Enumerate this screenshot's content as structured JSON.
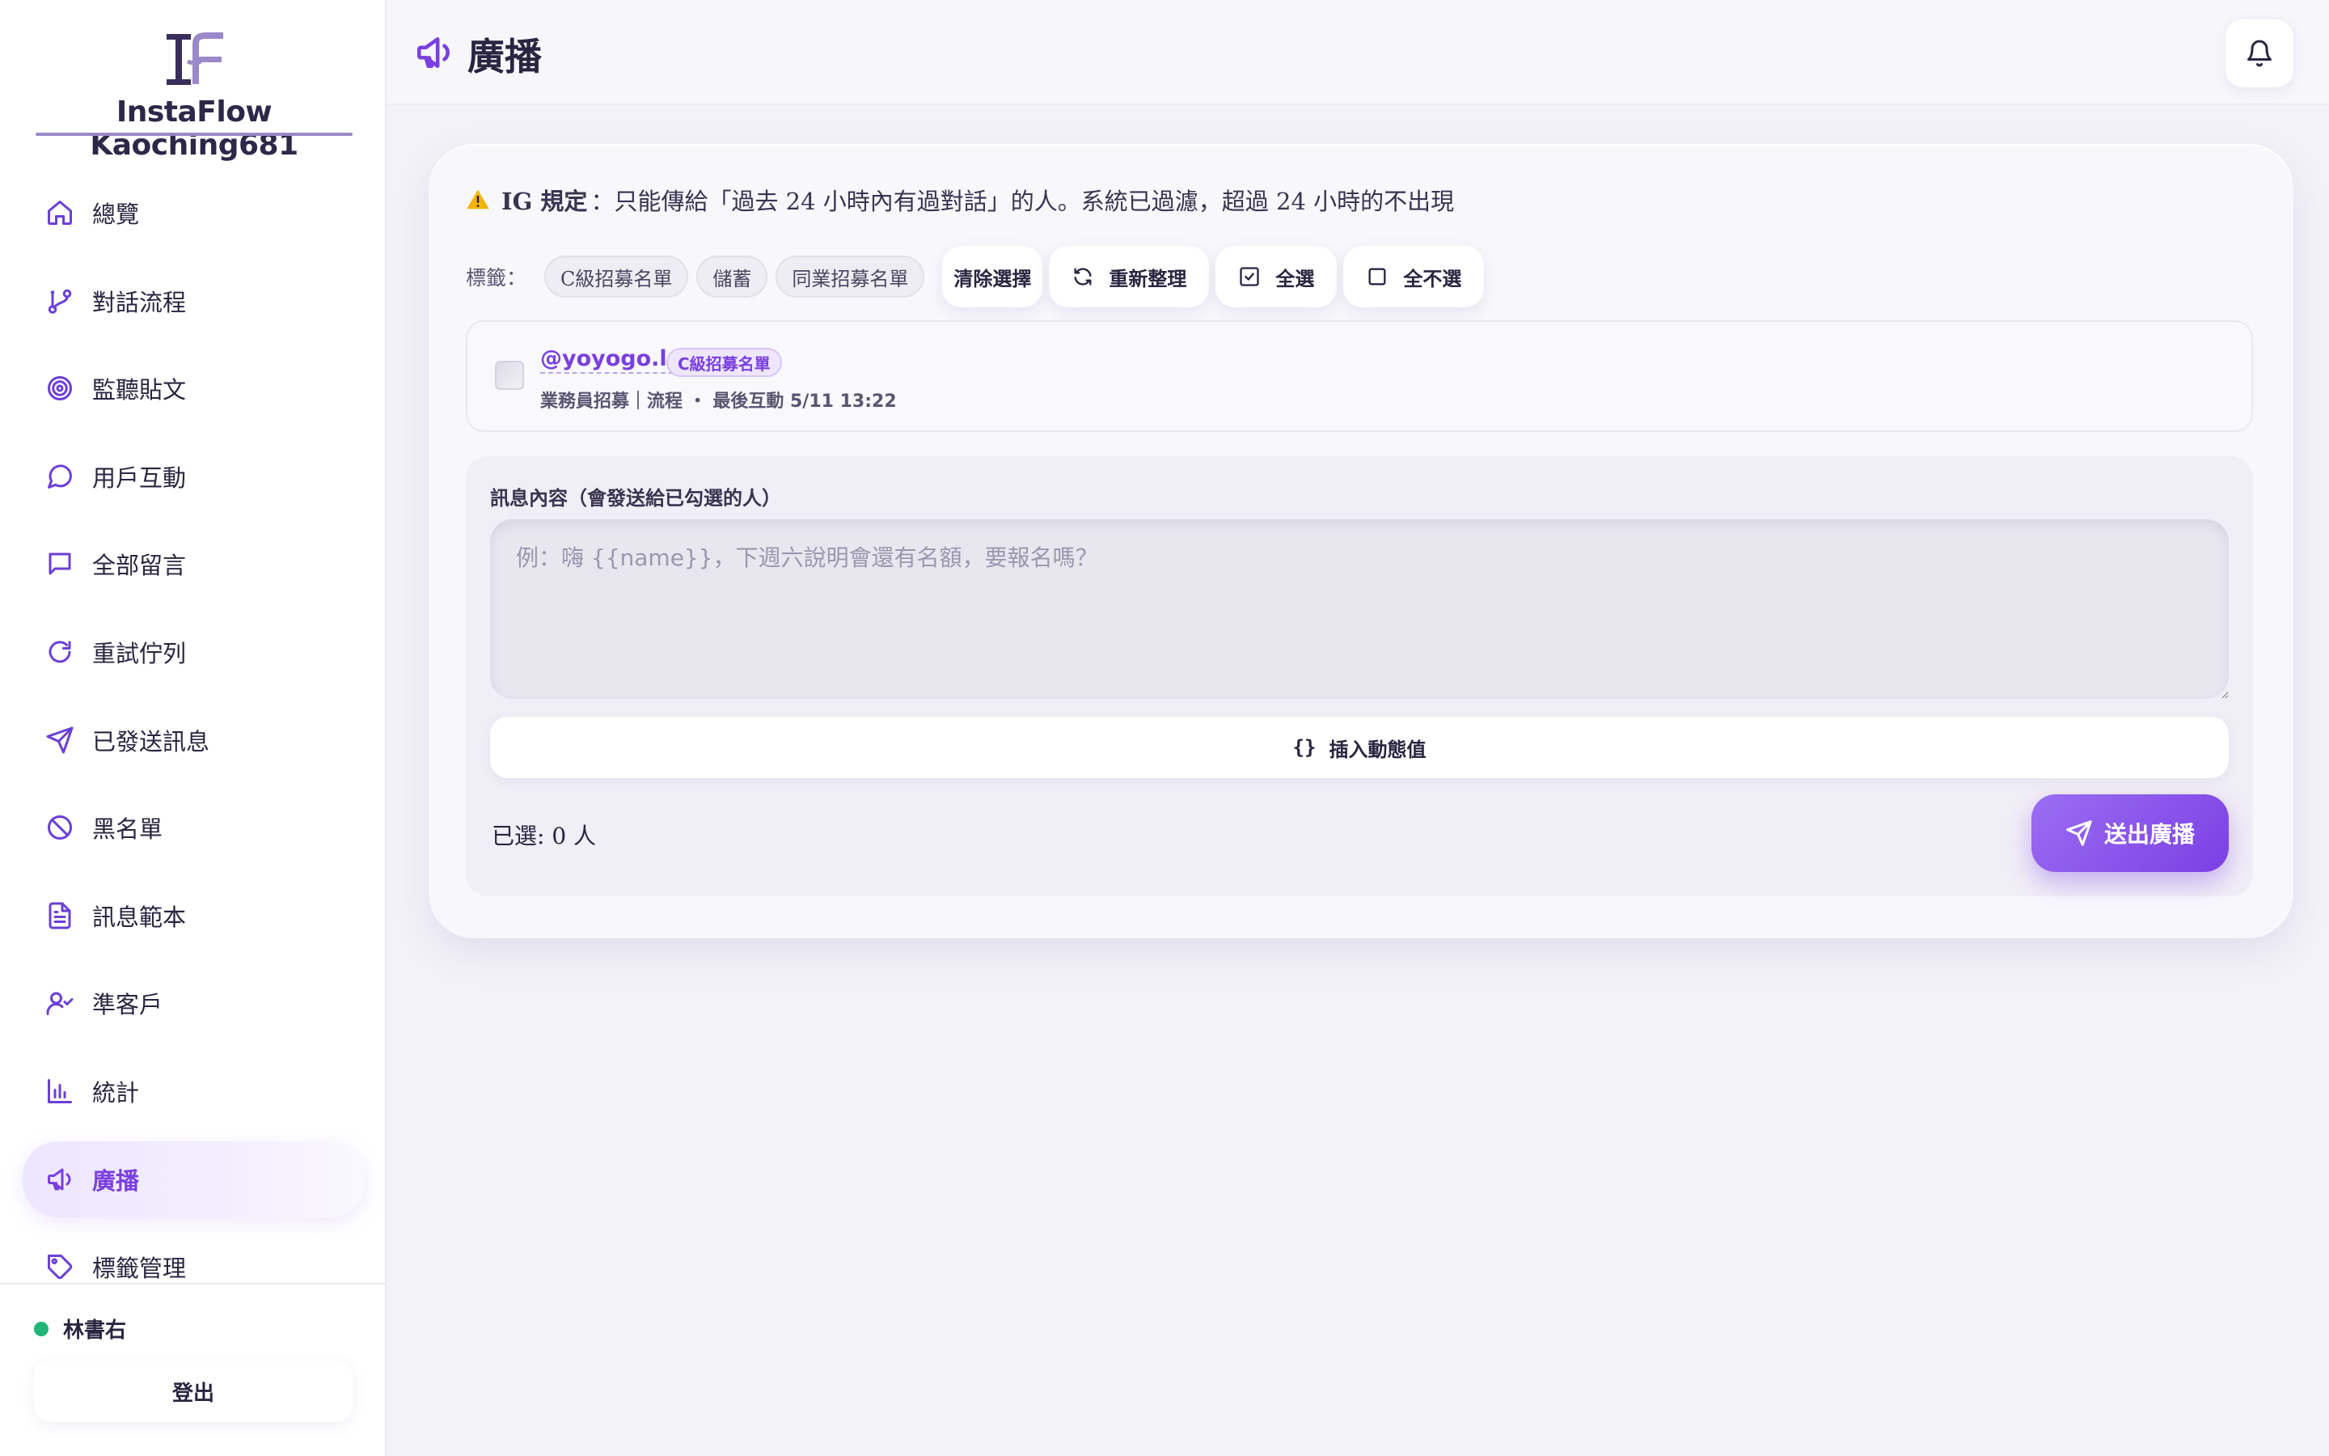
{
  "app": {
    "logo_text": "InstaFlow Kaoching681",
    "accent_color": "#7a3fe0"
  },
  "sidebar": {
    "items": [
      {
        "label": "總覽",
        "icon": "home-icon"
      },
      {
        "label": "對話流程",
        "icon": "git-branch-icon"
      },
      {
        "label": "監聽貼文",
        "icon": "target-icon"
      },
      {
        "label": "用戶互動",
        "icon": "chat-bubble-icon"
      },
      {
        "label": "全部留言",
        "icon": "message-square-icon"
      },
      {
        "label": "重試佇列",
        "icon": "refresh-icon"
      },
      {
        "label": "已發送訊息",
        "icon": "send-icon"
      },
      {
        "label": "黑名單",
        "icon": "ban-icon"
      },
      {
        "label": "訊息範本",
        "icon": "file-text-icon"
      },
      {
        "label": "準客戶",
        "icon": "user-check-icon"
      },
      {
        "label": "統計",
        "icon": "bar-chart-icon"
      },
      {
        "label": "廣播",
        "icon": "megaphone-icon",
        "active": true
      },
      {
        "label": "標籤管理",
        "icon": "tag-icon"
      }
    ],
    "user_name": "林書右",
    "user_status_color": "#21b477",
    "logout_label": "登出"
  },
  "header": {
    "title": "廣播",
    "title_icon": "megaphone-icon",
    "bell_icon": "bell-icon"
  },
  "broadcast": {
    "notice_label": "IG 規定",
    "notice_text": "：只能傳給「過去 24 小時內有過對話」的人。系統已過濾，超過 24 小時的不出現",
    "tags_label": "標籤：",
    "tags": [
      "C級招募名單",
      "儲蓄",
      "同業招募名單"
    ],
    "clear_selection_label": "清除選擇",
    "refresh_label": "重新整理",
    "select_all_label": "全選",
    "select_none_label": "全不選",
    "recipients": [
      {
        "handle": "@yoyogo.la",
        "badge": "C級招募名單",
        "meta": "業務員招募｜流程 ・ 最後互動 5/11 13:22",
        "checked": false
      }
    ],
    "compose_label": "訊息內容（會發送給已勾選的人）",
    "message_value": "",
    "message_placeholder": "例：嗨 {{name}}，下週六說明會還有名額，要報名嗎？",
    "insert_variable_label": "插入動態值",
    "selected_count_text": "已選: 0 人",
    "send_label": "送出廣播"
  }
}
